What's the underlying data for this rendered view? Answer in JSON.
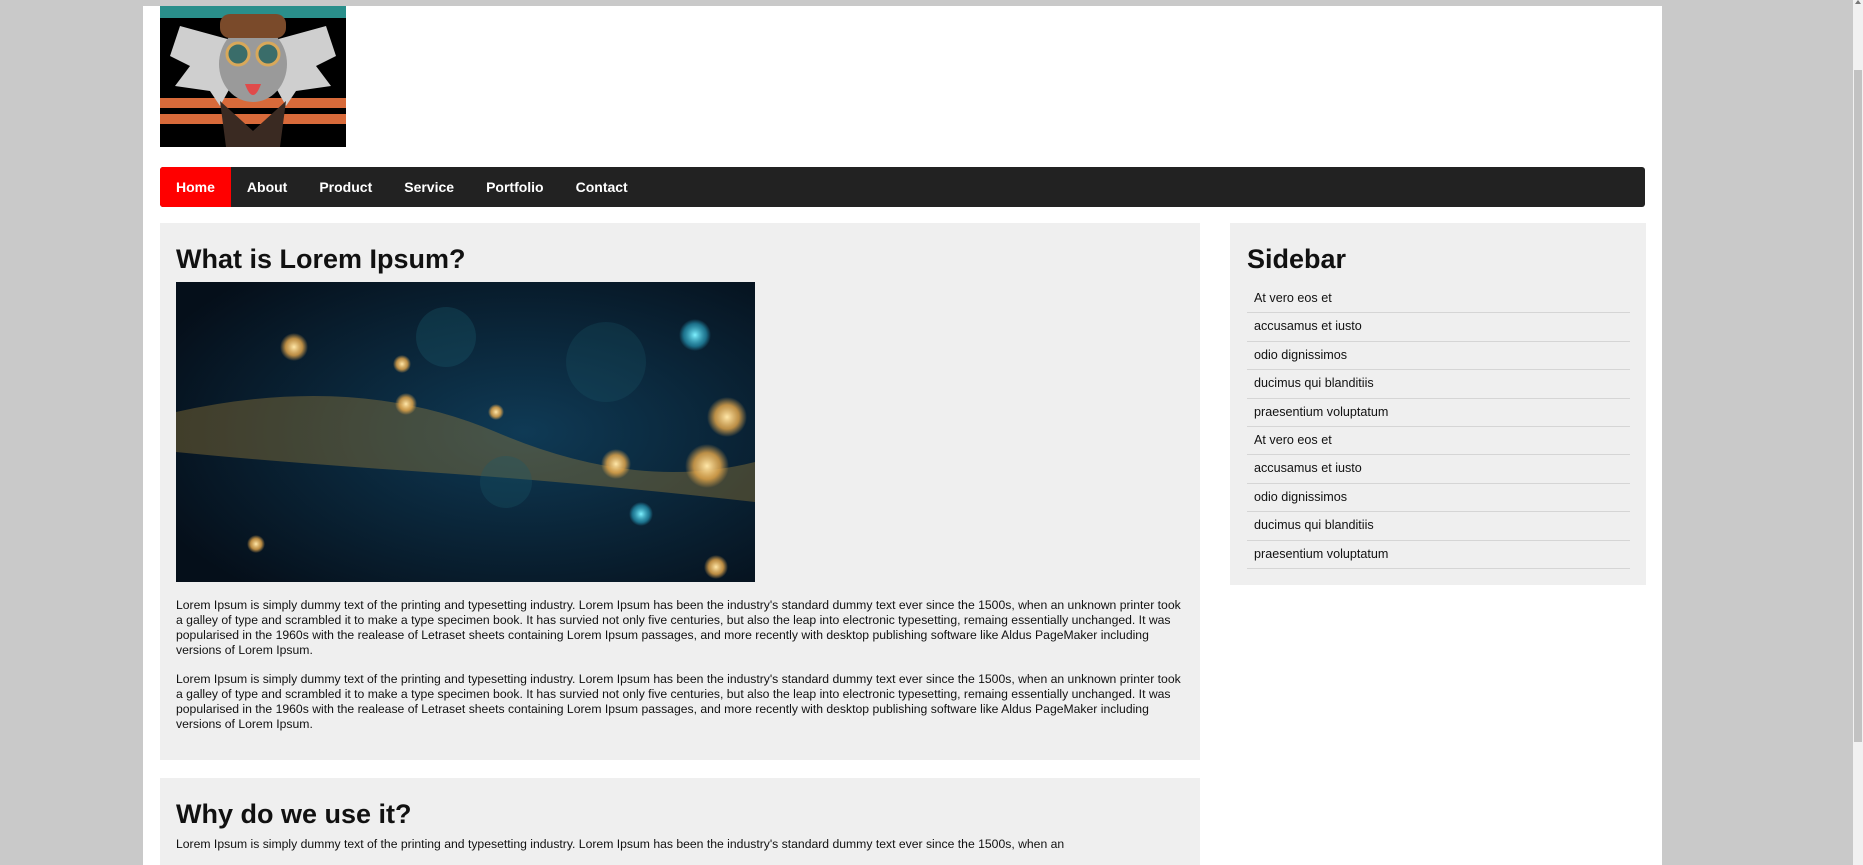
{
  "nav": {
    "items": [
      {
        "label": "Home",
        "active": true
      },
      {
        "label": "About"
      },
      {
        "label": "Product"
      },
      {
        "label": "Service"
      },
      {
        "label": "Portfolio"
      },
      {
        "label": "Contact"
      }
    ]
  },
  "main": {
    "sections": [
      {
        "title": "What is Lorem Ipsum?",
        "paragraphs": [
          "Lorem Ipsum is simply dummy text of the printing and typesetting industry. Lorem Ipsum has been the industry's standard dummy text ever since the 1500s, when an unknown printer took a galley of type and scrambled it to make a type specimen book. It has survied not only five centuries, but also the leap into electronic typesetting, remaing essentially unchanged. It was popularised in the 1960s with the realease of Letraset sheets containing Lorem Ipsum passages, and more recently with desktop publishing software like Aldus PageMaker including versions of Lorem Ipsum.",
          "Lorem Ipsum is simply dummy text of the printing and typesetting industry. Lorem Ipsum has been the industry's standard dummy text ever since the 1500s, when an unknown printer took a galley of type and scrambled it to make a type specimen book. It has survied not only five centuries, but also the leap into electronic typesetting, remaing essentially unchanged. It was popularised in the 1960s with the realease of Letraset sheets containing Lorem Ipsum passages, and more recently with desktop publishing software like Aldus PageMaker including versions of Lorem Ipsum."
        ]
      },
      {
        "title": "Why do we use it?",
        "paragraphs": [
          "Lorem Ipsum is simply dummy text of the printing and typesetting industry. Lorem Ipsum has been the industry's standard dummy text ever since the 1500s, when an"
        ]
      }
    ]
  },
  "sidebar": {
    "title": "Sidebar",
    "items": [
      "At vero eos et",
      "accusamus et iusto",
      "odio dignissimos",
      "ducimus qui blanditiis",
      "praesentium voluptatum",
      "At vero eos et",
      "accusamus et iusto",
      "odio dignissimos",
      "ducimus qui blanditiis",
      "praesentium voluptatum"
    ]
  },
  "colors": {
    "nav_active": "#ff0000",
    "nav_background": "#222222",
    "card_background": "#efefef",
    "page_background": "#c9c9c9"
  }
}
